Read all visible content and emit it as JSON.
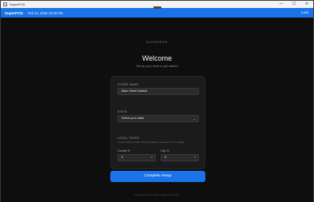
{
  "window": {
    "title": "SuperPOS",
    "minimize": "—",
    "maximize": "☐",
    "close": "✕"
  },
  "appbar": {
    "brand": "SuperPOS",
    "datetime": "Feb 22, 2026 10:08 PM",
    "lock_label": "Lock"
  },
  "setup": {
    "brandmark": "SUPERPOS",
    "title": "Welcome",
    "subtitle": "Set up your store to get started",
    "store_name_label": "STORE NAME",
    "store_name_value": "Main Street Market",
    "state_label": "STATE",
    "state_value": "Select your state",
    "local_taxes_label": "LOCAL TAXES",
    "local_taxes_hint": "County and city rates vary by location. Leave at 0 if none apply.",
    "county_label": "County %",
    "county_value": "0",
    "city_label": "City %",
    "city_value": "0",
    "complete_button": "Complete Setup",
    "footer": "No taxes are set until you save the config."
  }
}
